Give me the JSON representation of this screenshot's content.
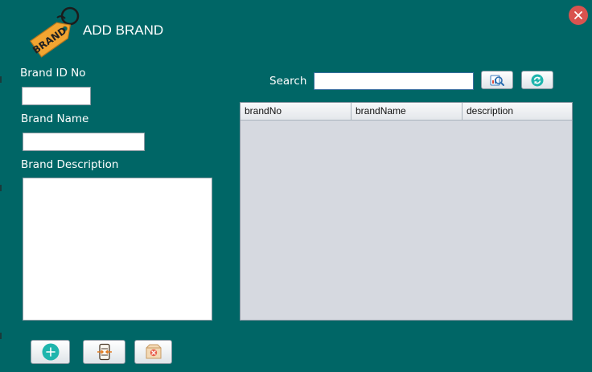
{
  "window": {
    "title": "ADD BRAND",
    "logo_text": "BRAND"
  },
  "form": {
    "brand_id_label": "Brand ID No",
    "brand_id_value": "",
    "brand_name_label": "Brand Name",
    "brand_name_value": "",
    "brand_description_label": "Brand Description",
    "brand_description_value": ""
  },
  "search": {
    "label": "Search",
    "value": ""
  },
  "table": {
    "columns": [
      "brandNo",
      "brandName",
      "description"
    ],
    "rows": []
  },
  "icons": {
    "close": "close-icon",
    "search_button": "search-report-icon",
    "refresh_button": "refresh-icon",
    "add_button": "add-icon",
    "update_button": "update-document-icon",
    "delete_button": "delete-box-icon"
  },
  "colors": {
    "background": "#006666",
    "close": "#d9534f",
    "table_body": "#d6d9e0",
    "accent": "#1fb5ad"
  }
}
